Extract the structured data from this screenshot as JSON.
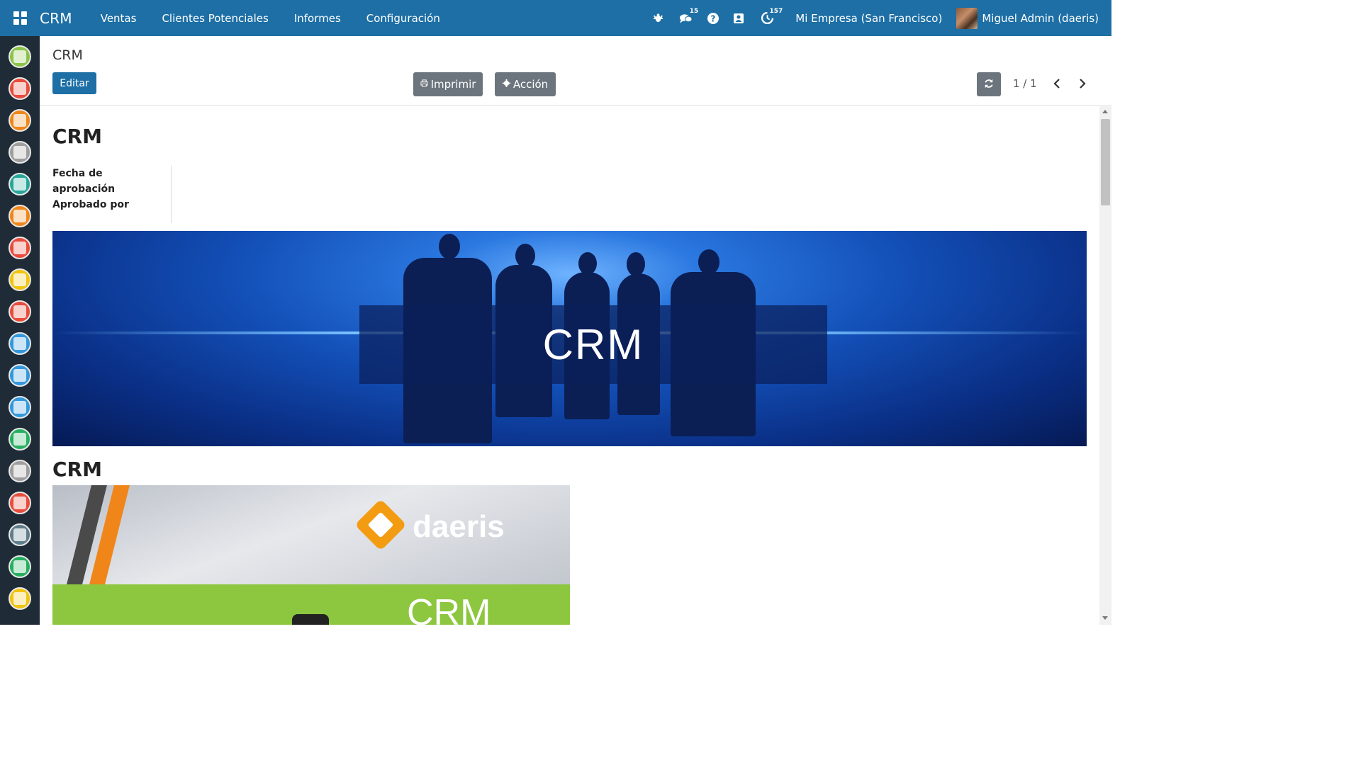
{
  "navbar": {
    "app_name": "CRM",
    "menu": [
      "Ventas",
      "Clientes Potenciales",
      "Informes",
      "Configuración"
    ],
    "messages_count": "15",
    "activities_count": "157",
    "company": "Mi Empresa (San Francisco)",
    "user": "Miguel Admin (daeris)"
  },
  "sidebar": {
    "apps": [
      {
        "icon": "discuss-icon",
        "color": "#8bc34a"
      },
      {
        "icon": "calendar-icon",
        "color": "#e74c3c"
      },
      {
        "icon": "notes-icon",
        "color": "#f0861a"
      },
      {
        "icon": "contacts-icon",
        "color": "#9e9e9e"
      },
      {
        "icon": "employees-icon",
        "color": "#26a69a"
      },
      {
        "icon": "crm-icon",
        "color": "#f0861a"
      },
      {
        "icon": "sales-icon",
        "color": "#e74c3c"
      },
      {
        "icon": "website-icon",
        "color": "#f1c40f"
      },
      {
        "icon": "expenses-icon",
        "color": "#e74c3c"
      },
      {
        "icon": "point-of-sale-icon",
        "color": "#3498db"
      },
      {
        "icon": "invoicing-icon",
        "color": "#3498db"
      },
      {
        "icon": "planning-icon",
        "color": "#3498db"
      },
      {
        "icon": "maintenance-icon",
        "color": "#27ae60"
      },
      {
        "icon": "shop-icon",
        "color": "#9e9e9e"
      },
      {
        "icon": "events-icon",
        "color": "#e74c3c"
      },
      {
        "icon": "surveys-icon",
        "color": "#607d8b"
      },
      {
        "icon": "marketing-icon",
        "color": "#27ae60"
      },
      {
        "icon": "inventory-icon",
        "color": "#f1c40f"
      }
    ]
  },
  "control_panel": {
    "breadcrumb": "CRM",
    "edit_label": "Editar",
    "print_label": "Imprimir",
    "action_label": "Acción",
    "pager": "1 / 1"
  },
  "document": {
    "title": "CRM",
    "fields": [
      "Fecha de aprobación",
      "Aprobado por"
    ],
    "banner_text": "CRM",
    "section_title": "CRM",
    "video_brand": "daeris",
    "video_title": "CRM"
  }
}
